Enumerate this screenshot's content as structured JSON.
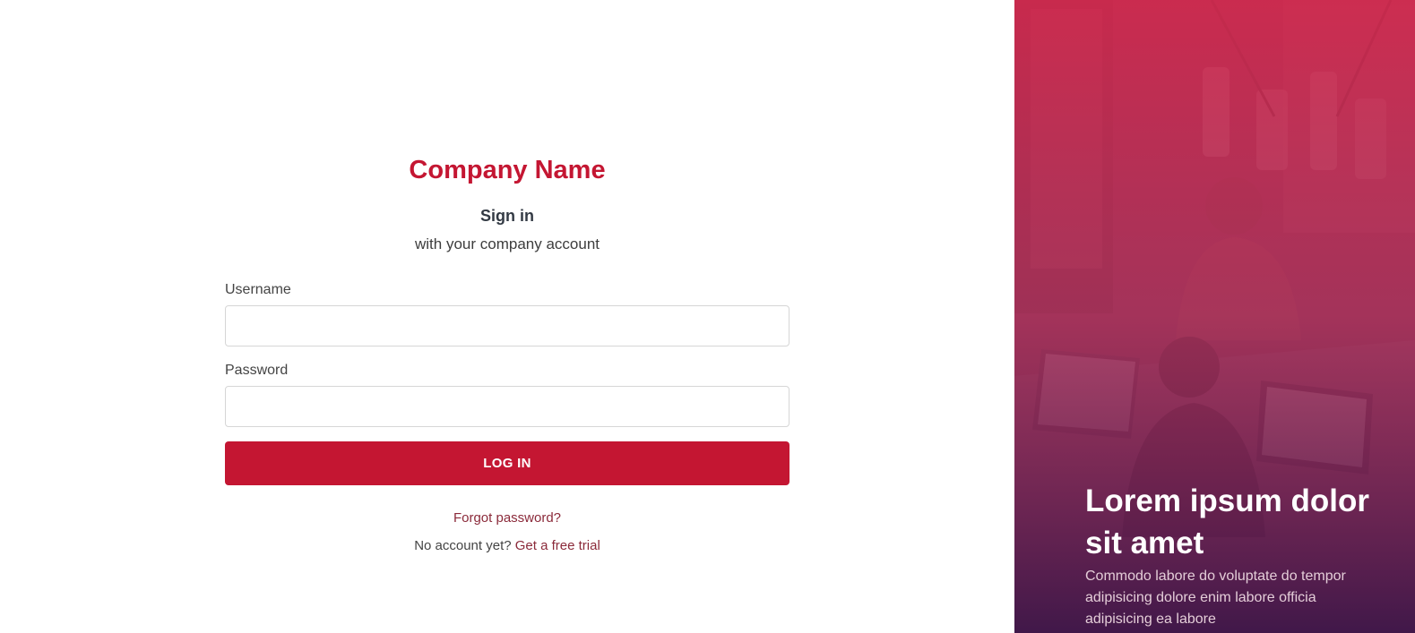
{
  "brand": {
    "company_name": "Company Name",
    "accent_color": "#c41632"
  },
  "login": {
    "heading": "Sign in",
    "subheading": "with your company account",
    "username_label": "Username",
    "username_value": "",
    "password_label": "Password",
    "password_value": "",
    "submit_label": "LOG IN",
    "forgot_link": "Forgot password?",
    "no_account_text": "No account yet?",
    "trial_link": "Get a free trial"
  },
  "hero": {
    "title": "Lorem ipsum dolor sit amet",
    "body": "Commodo labore do voluptate do tempor adipisicing dolore enim labore officia adipisicing ea labore",
    "image": "office-team-photo"
  }
}
